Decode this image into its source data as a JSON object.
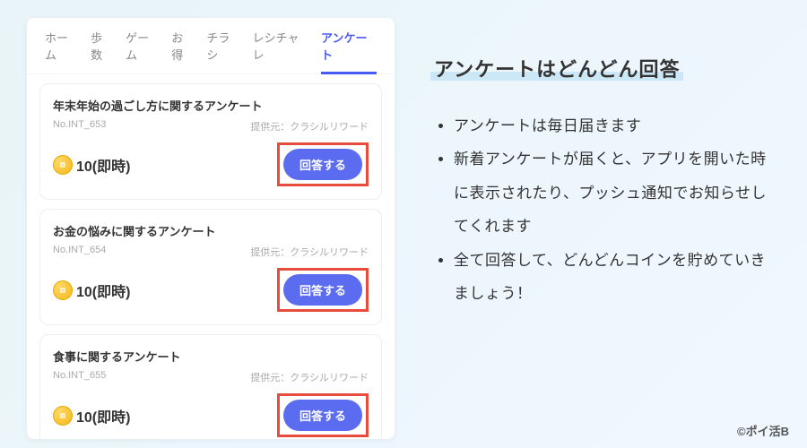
{
  "tabs": [
    "ホーム",
    "歩数",
    "ゲーム",
    "お得",
    "チラシ",
    "レシチャレ",
    "アンケート"
  ],
  "active_tab_index": 6,
  "provider_label": "提供元：",
  "surveys": [
    {
      "title": "年末年始の過ごし方に関するアンケート",
      "id": "No.INT_653",
      "provider": "クラシルリワード",
      "reward": "10(即時)",
      "button": "回答する"
    },
    {
      "title": "お金の悩みに関するアンケート",
      "id": "No.INT_654",
      "provider": "クラシルリワード",
      "reward": "10(即時)",
      "button": "回答する"
    },
    {
      "title": "食事に関するアンケート",
      "id": "No.INT_655",
      "provider": "クラシルリワード",
      "reward": "10(即時)",
      "button": "回答する"
    }
  ],
  "heading": "アンケートはどんどん回答",
  "bullets": [
    "アンケートは毎日届きます",
    "新着アンケートが届くと、アプリを開いた時に表示されたり、プッシュ通知でお知らせしてくれます",
    "全て回答して、どんどんコインを貯めていきましょう！"
  ],
  "credit": "©ポイ活B"
}
